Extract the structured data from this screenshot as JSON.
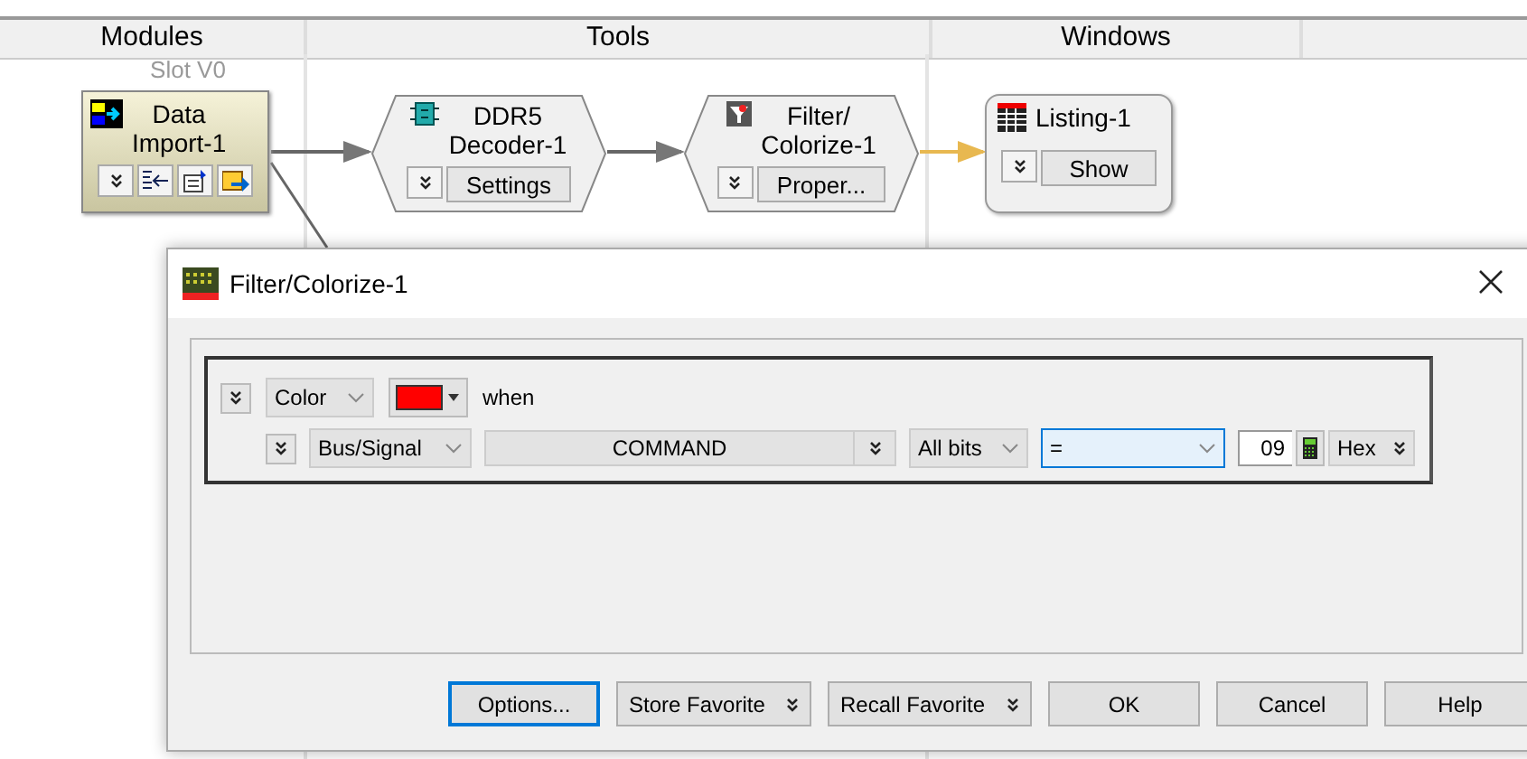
{
  "columns": [
    {
      "label": "Modules"
    },
    {
      "label": "Tools"
    },
    {
      "label": "Windows"
    }
  ],
  "slot_label": "Slot V0",
  "nodes": [
    {
      "kind": "module",
      "title_lines": [
        "Data",
        "Import-1"
      ]
    },
    {
      "kind": "tool",
      "title_lines": [
        "DDR5",
        "Decoder-1"
      ],
      "button": "Settings"
    },
    {
      "kind": "tool",
      "title_lines": [
        "Filter/",
        "Colorize-1"
      ],
      "button": "Proper..."
    },
    {
      "kind": "window",
      "title_lines": [
        "Listing-1"
      ],
      "button": "Show"
    }
  ],
  "dialog": {
    "title": "Filter/Colorize-1",
    "rule": {
      "action": "Color",
      "color": "#ff0000",
      "when_label": "when"
    },
    "condition": {
      "source": "Bus/Signal",
      "signal": "COMMAND",
      "bits": "All bits",
      "operator": {
        "value": "=",
        "focused": true
      },
      "value": "09",
      "radix": "Hex"
    },
    "buttons": [
      {
        "label": "Options...",
        "default": true,
        "menu": false
      },
      {
        "label": "Store Favorite",
        "default": false,
        "menu": true
      },
      {
        "label": "Recall Favorite",
        "default": false,
        "menu": true
      },
      {
        "label": "OK",
        "default": false,
        "menu": false
      },
      {
        "label": "Cancel",
        "default": false,
        "menu": false
      },
      {
        "label": "Help",
        "default": false,
        "menu": false
      }
    ]
  }
}
